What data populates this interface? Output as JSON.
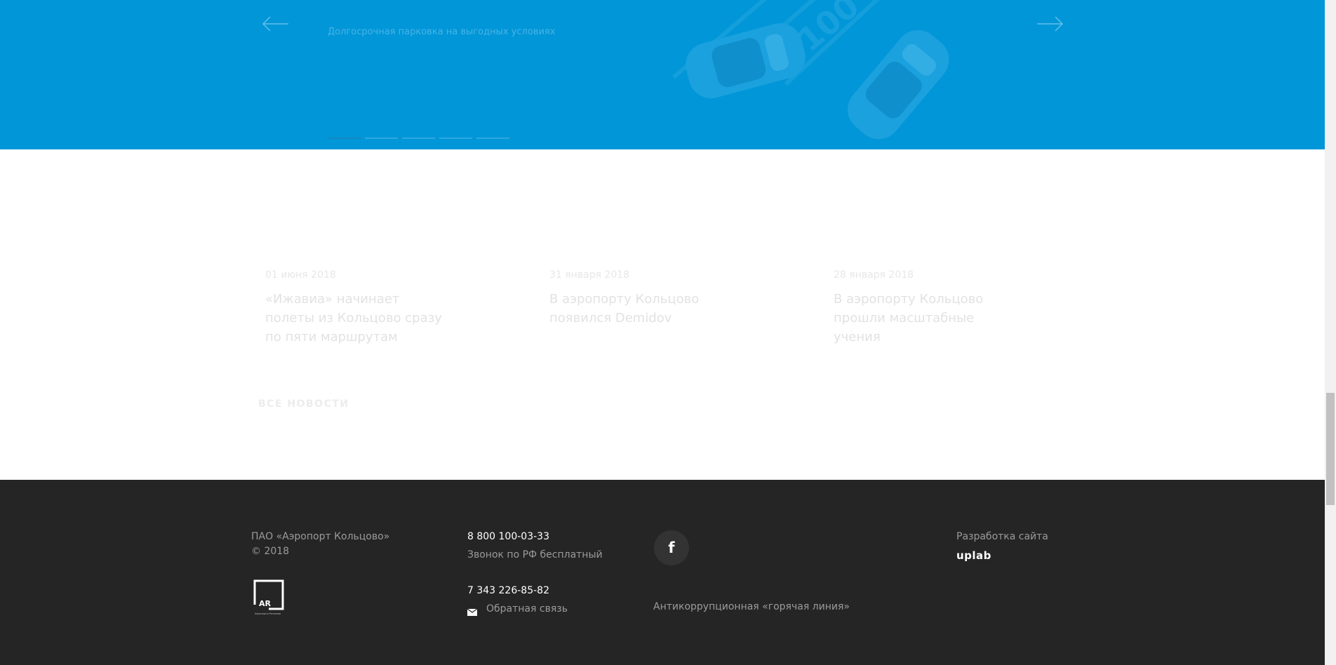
{
  "hero": {
    "slide_caption": "Долгосрочная парковка на выгодных условиях",
    "illustration_number": "100",
    "slides": [
      "1",
      "2",
      "3",
      "4",
      "5"
    ]
  },
  "news": {
    "items": [
      {
        "date": "01 июня 2018",
        "title": "«Ижавиа» начинает полеты из Кольцово сразу по пяти маршрутам"
      },
      {
        "date": "31 января 2018",
        "title": "В аэропорту Кольцово появился Demidov"
      },
      {
        "date": "28 января 2018",
        "title": "В аэропорту Кольцово прошли масштабные учения"
      }
    ],
    "all_news_label": "ВСЕ НОВОСТИ"
  },
  "footer": {
    "company": "ПАО «Аэропорт Кольцово»",
    "copyright": "© 2018",
    "logo_text": "AR",
    "logo_subtext": "Аэропорты Регионов",
    "phone1": "8 800 100-03-33",
    "phone1_note": "Звонок по РФ бесплатный",
    "phone2": "7 343 226-85-82",
    "feedback": "Обратная связь",
    "facebook_letter": "f",
    "hotline": "Антикоррупционная «горячая линия»",
    "dev_label": "Разработка сайта",
    "dev_name": "uplab"
  },
  "colors": {
    "hero_blue": "#0096d8",
    "footer_bg": "#252525"
  }
}
